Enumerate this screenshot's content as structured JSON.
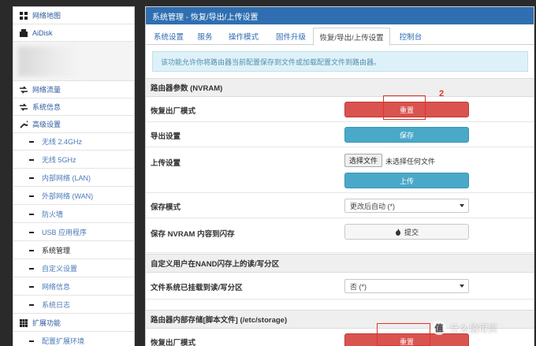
{
  "sidebar": {
    "items": [
      {
        "label": "网络地图",
        "icon": "map-icon"
      },
      {
        "label": "AiDisk",
        "icon": "disk-icon"
      },
      {
        "label": "网络流量",
        "icon": "traffic-icon"
      },
      {
        "label": "系统信息",
        "icon": "info-icon"
      },
      {
        "label": "高级设置",
        "icon": "wrench-icon"
      }
    ],
    "sub_items": [
      "无线 2.4GHz",
      "无线 5GHz",
      "内部网络 (LAN)",
      "外部网络 (WAN)",
      "防火墙",
      "USB 应用程序",
      "系统管理",
      "自定义设置",
      "网络信息",
      "系统日志"
    ],
    "active_sub": "系统管理",
    "ext_label": "扩展功能",
    "ext_sub": "配置扩展环境"
  },
  "main": {
    "title": "系统管理 - 恢复/导出/上传设置",
    "tabs": [
      "系统设置",
      "服务",
      "操作模式",
      "固件升级",
      "恢复/导出/上传设置",
      "控制台"
    ],
    "active_tab": "恢复/导出/上传设置",
    "info": "该功能允许你将路由器当前配置保存到文件或加载配置文件到路由器。",
    "section1": {
      "title": "路由器参数 (NVRAM)",
      "restore_label": "恢复出厂模式",
      "restore_btn": "重置",
      "export_label": "导出设置",
      "export_btn": "保存",
      "upload_label": "上传设置",
      "choose_file_btn": "选择文件",
      "no_file_text": "未选择任何文件",
      "upload_btn": "上传",
      "save_mode_label": "保存模式",
      "save_mode_value": "更改后自动 (*)",
      "save_nvram_label": "保存 NVRAM 内容到闪存",
      "submit_btn": "提交"
    },
    "section2": {
      "title": "自定义用户在NAND闪存上的读/写分区",
      "mounted_label": "文件系统已挂载到读/写分区",
      "mounted_value": "否 (*)"
    },
    "section3": {
      "title": "路由器内部存储[脚本文件] (/etc/storage)",
      "restore_label": "恢复出厂模式",
      "restore_btn": "重置"
    }
  },
  "annotation": {
    "number": "2"
  },
  "watermark": {
    "badge": "值",
    "text": "什么值得买"
  },
  "colors": {
    "title_bar": "#2f6fb1",
    "danger": "#d9534f",
    "info": "#4aa9c8",
    "annotation": "#e0332a"
  }
}
